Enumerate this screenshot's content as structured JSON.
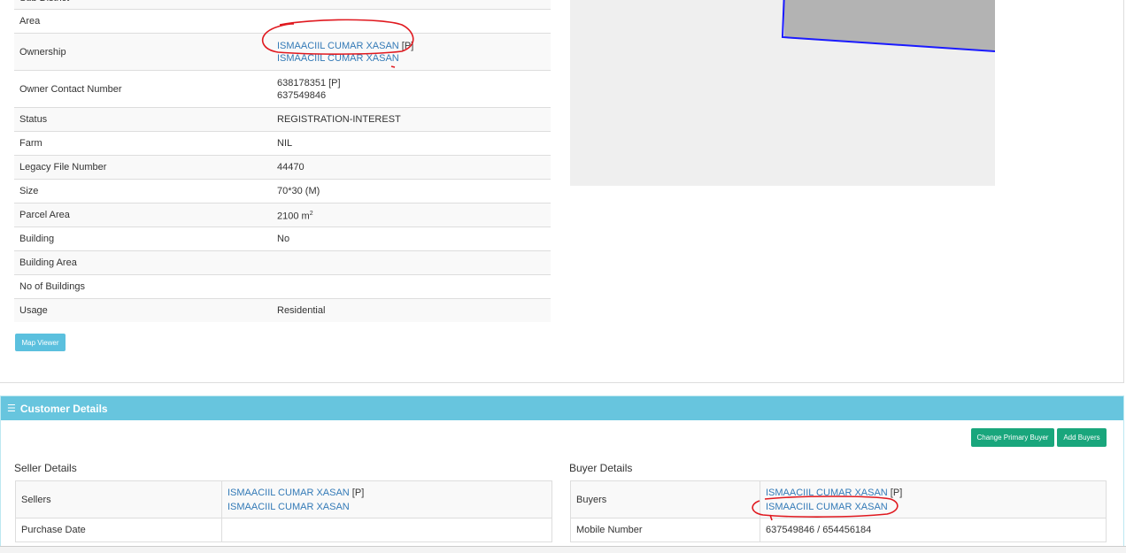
{
  "parcel": {
    "rows": [
      {
        "label": "Sub District",
        "value": ""
      },
      {
        "label": "Area",
        "value": ""
      },
      {
        "label": "Ownership",
        "links": [
          "ISMAACIIL CUMAR XASAN",
          "ISMAACIIL CUMAR XASAN"
        ],
        "suffix": "[P]"
      },
      {
        "label": "Owner Contact Number",
        "lines": [
          "638178351 [P]",
          "637549846"
        ]
      },
      {
        "label": "Status",
        "value": "REGISTRATION-INTEREST"
      },
      {
        "label": "Farm",
        "value": "NIL"
      },
      {
        "label": "Legacy File Number",
        "value": "44470"
      },
      {
        "label": "Size",
        "value": "70*30 (M)"
      },
      {
        "label": "Parcel Area",
        "value": "2100 m",
        "unit_sup": "2"
      },
      {
        "label": "Building",
        "value": "No"
      },
      {
        "label": "Building Area",
        "value": ""
      },
      {
        "label": "No of Buildings",
        "value": ""
      },
      {
        "label": "Usage",
        "value": "Residential"
      }
    ],
    "map_viewer_label": "Map Viewer"
  },
  "customer": {
    "header": "Customer Details",
    "change_primary_buyer_label": "Change Primary Buyer",
    "add_buyers_label": "Add Buyers",
    "seller": {
      "title": "Seller Details",
      "sellers_label": "Sellers",
      "sellers": [
        "ISMAACIIL CUMAR XASAN",
        "ISMAACIIL CUMAR XASAN"
      ],
      "primary_suffix": "[P]",
      "purchase_date_label": "Purchase Date",
      "purchase_date": ""
    },
    "buyer": {
      "title": "Buyer Details",
      "buyers_label": "Buyers",
      "buyers": [
        "ISMAACIIL CUMAR XASAN",
        "ISMAACIIL CUMAR XASAN"
      ],
      "primary_suffix": "[P]",
      "mobile_label": "Mobile Number",
      "mobile": "637549846 / 654456184"
    }
  },
  "colors": {
    "header_bg": "#67c5de",
    "link": "#337ab7",
    "green_button": "#19a67c",
    "info_button": "#5bc0de",
    "annotation": "#e0191f",
    "parcel_outline": "#1a1aff",
    "parcel_fill": "#b3b3b3"
  },
  "icons": {
    "header_icon": "list-icon"
  }
}
